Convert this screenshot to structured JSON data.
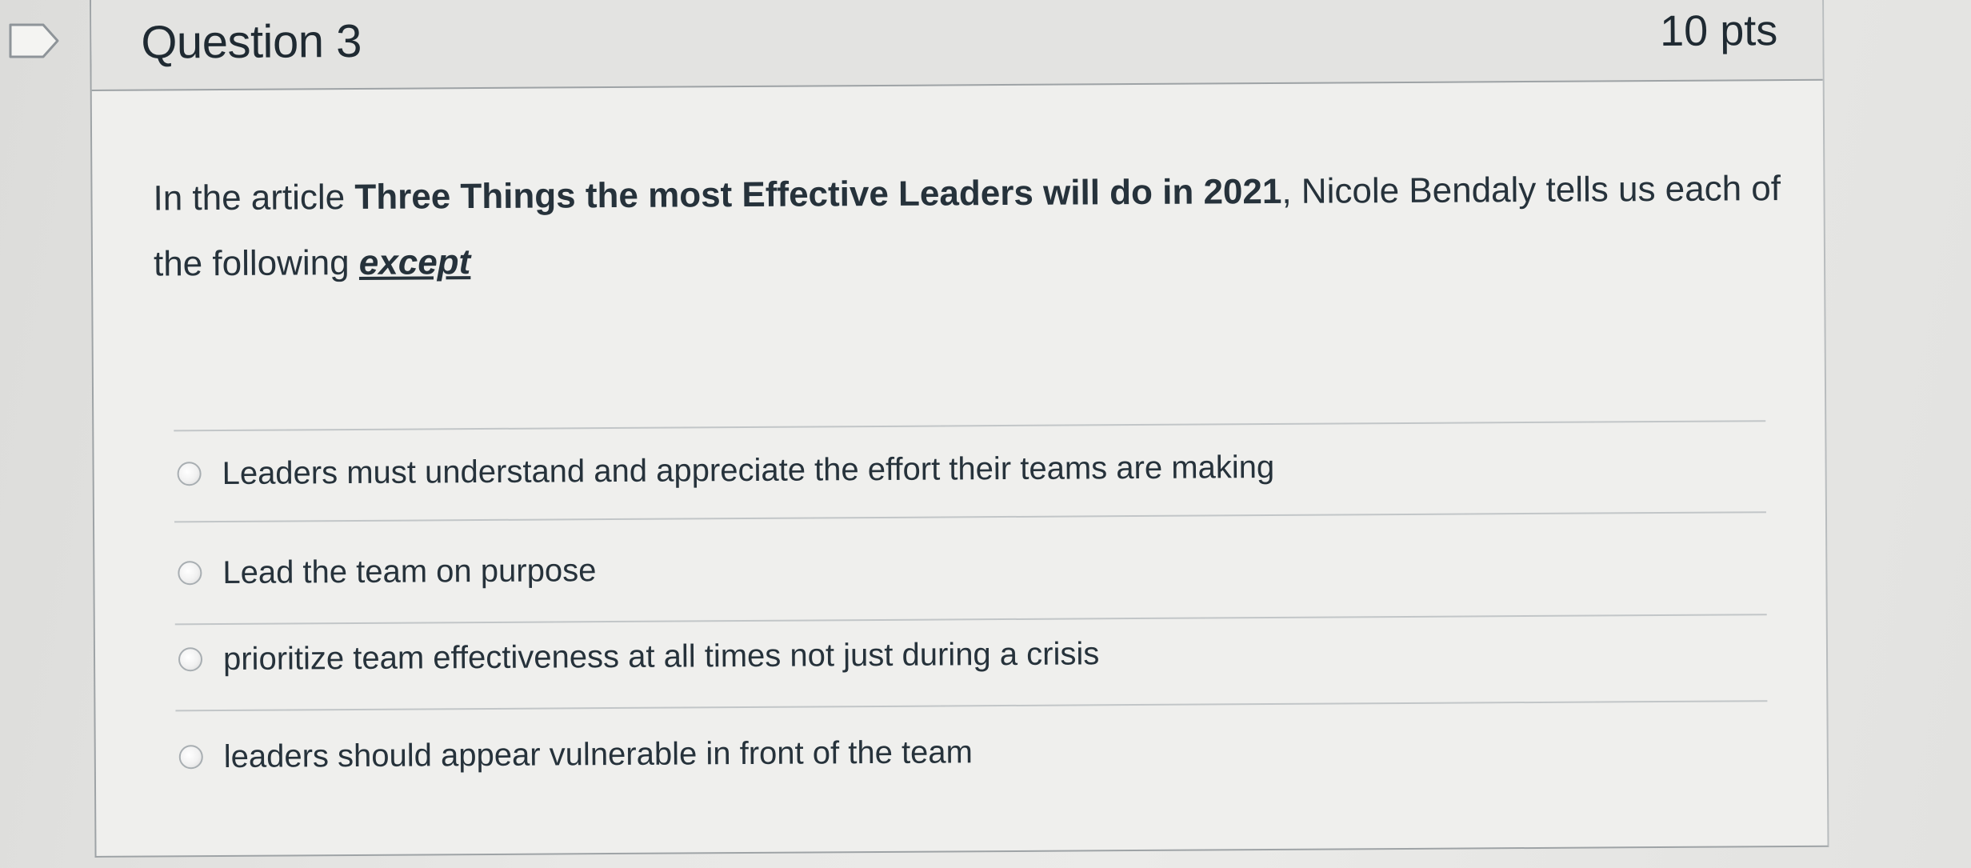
{
  "question": {
    "title": "Question 3",
    "points": "10 pts",
    "text_prefix": "In the article ",
    "text_bold": "Three Things the most Effective Leaders will do in 2021",
    "text_middle": ", Nicole Bendaly tells us each of the following ",
    "text_except": "except",
    "flag_icon": "flag-icon"
  },
  "answers": [
    {
      "label": "Leaders must understand and appreciate the effort their teams are making",
      "selected": false,
      "icon": "radio-icon"
    },
    {
      "label": "Lead the team on purpose",
      "selected": false,
      "icon": "radio-icon"
    },
    {
      "label": "prioritize team effectiveness at all times not just during a crisis",
      "selected": false,
      "icon": "radio-icon"
    },
    {
      "label": "leaders should appear vulnerable in front of the team",
      "selected": false,
      "icon": "radio-icon"
    }
  ]
}
